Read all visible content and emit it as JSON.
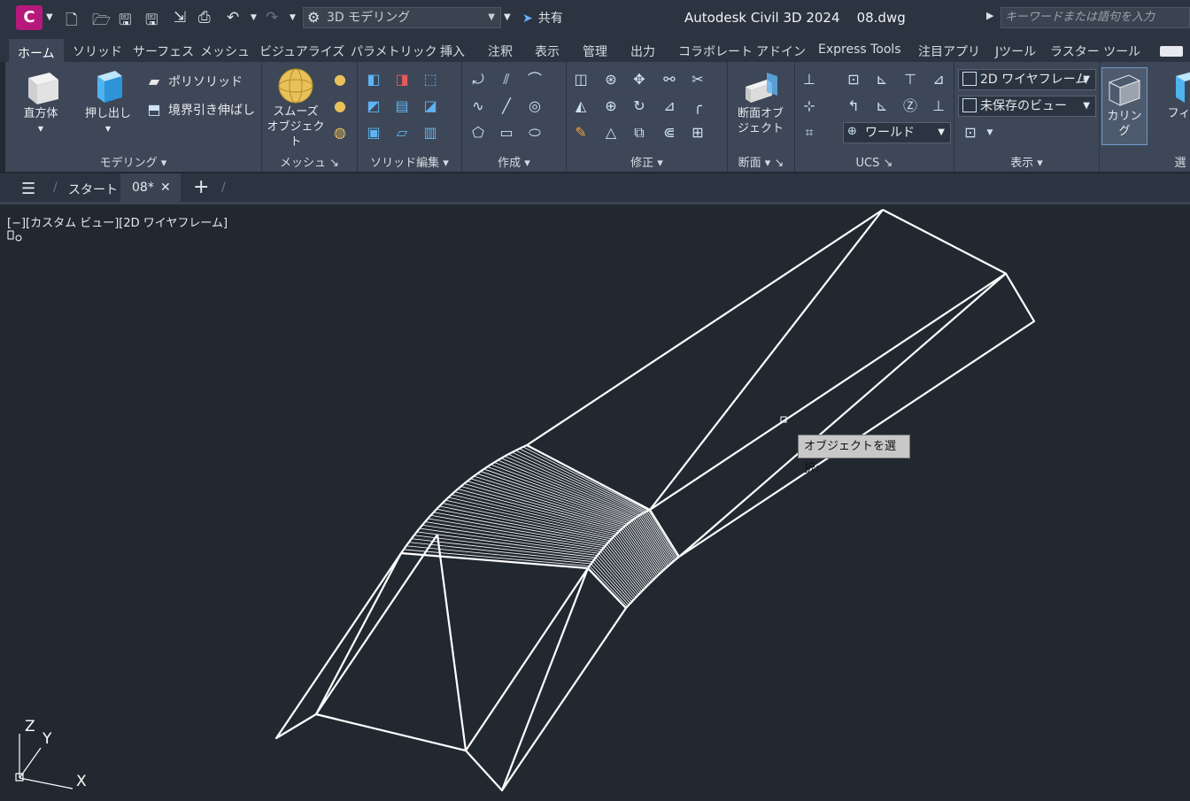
{
  "titlebar": {
    "app_letter": "C",
    "workspace": "3D モデリング",
    "share": "共有",
    "title": "Autodesk Civil 3D 2024    08.dwg",
    "search_placeholder": "キーワードまたは語句を入力"
  },
  "ribbon_tabs": [
    "ホーム",
    "ソリッド",
    "サーフェス",
    "メッシュ",
    "ビジュアライズ",
    "パラメトリック",
    "挿入",
    "注釈",
    "表示",
    "管理",
    "出力",
    "コラボレート",
    "アドイン",
    "Express Tools",
    "注目アプリ",
    "Jツール",
    "ラスター ツール"
  ],
  "panels": {
    "modeling": {
      "label": "モデリング",
      "box": "直方体",
      "extrude": "押し出し",
      "polysolid": "ポリソリッド",
      "presspull": "境界引き伸ばし"
    },
    "mesh": {
      "label": "メッシュ",
      "smooth_line1": "スムーズ",
      "smooth_line2": "オブジェクト"
    },
    "solid_edit": {
      "label": "ソリッド編集"
    },
    "draw": {
      "label": "作成"
    },
    "modify": {
      "label": "修正"
    },
    "section": {
      "label": "断面",
      "btn_line1": "断面オブ",
      "btn_line2": "ジェクト"
    },
    "ucs": {
      "label": "UCS",
      "world": "ワールド"
    },
    "view": {
      "label": "表示",
      "visual_style": "2D ワイヤフレーム",
      "named_view": "未保存のビュー"
    },
    "culling": {
      "label": "カリング",
      "filter": "フィル",
      "select_partial": "選"
    }
  },
  "filetabs": {
    "start": "スタート",
    "current": "08*"
  },
  "viewport": {
    "label": "[−][カスタム ビュー][2D ワイヤフレーム]",
    "tooltip": "オブジェクトを選択:",
    "axis_z": "Z",
    "axis_y": "Y",
    "axis_x": "X"
  }
}
